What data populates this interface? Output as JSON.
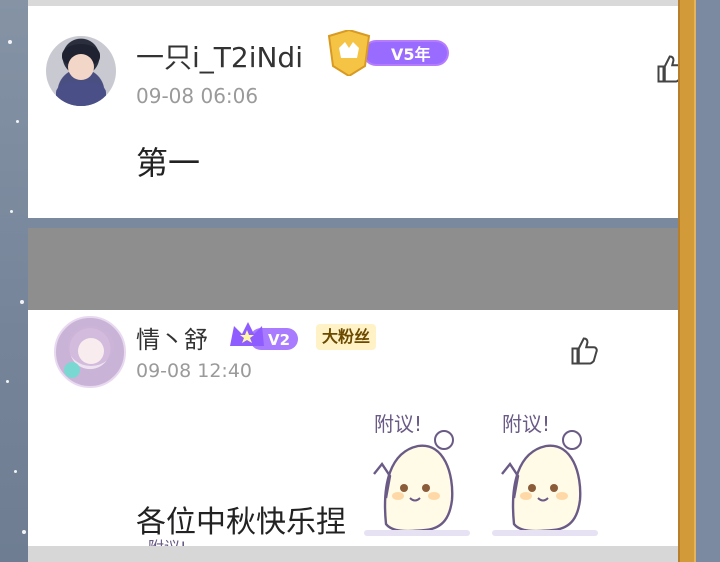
{
  "posts": [
    {
      "username": "一只i_T2iNdi",
      "badge_level": "V5年",
      "time": "09-08 06:06",
      "content": "第一"
    },
    {
      "username": "情丶舒",
      "badge_level": "V2",
      "fan_badge": "大粉丝",
      "time": "09-08 12:40",
      "content": "各位中秋快乐捏",
      "sticker_text": "附议!",
      "peek_text": "附议!"
    }
  ],
  "colors": {
    "frame": "#d39a3a",
    "badge_purple": "#9a6bff",
    "badge_gold": "#f6c444",
    "fan_badge_bg": "#fff2c6"
  },
  "icons": {
    "like": "thumbs-up-icon",
    "crown": "crown-icon",
    "sparkle": "sparkle-icon"
  }
}
